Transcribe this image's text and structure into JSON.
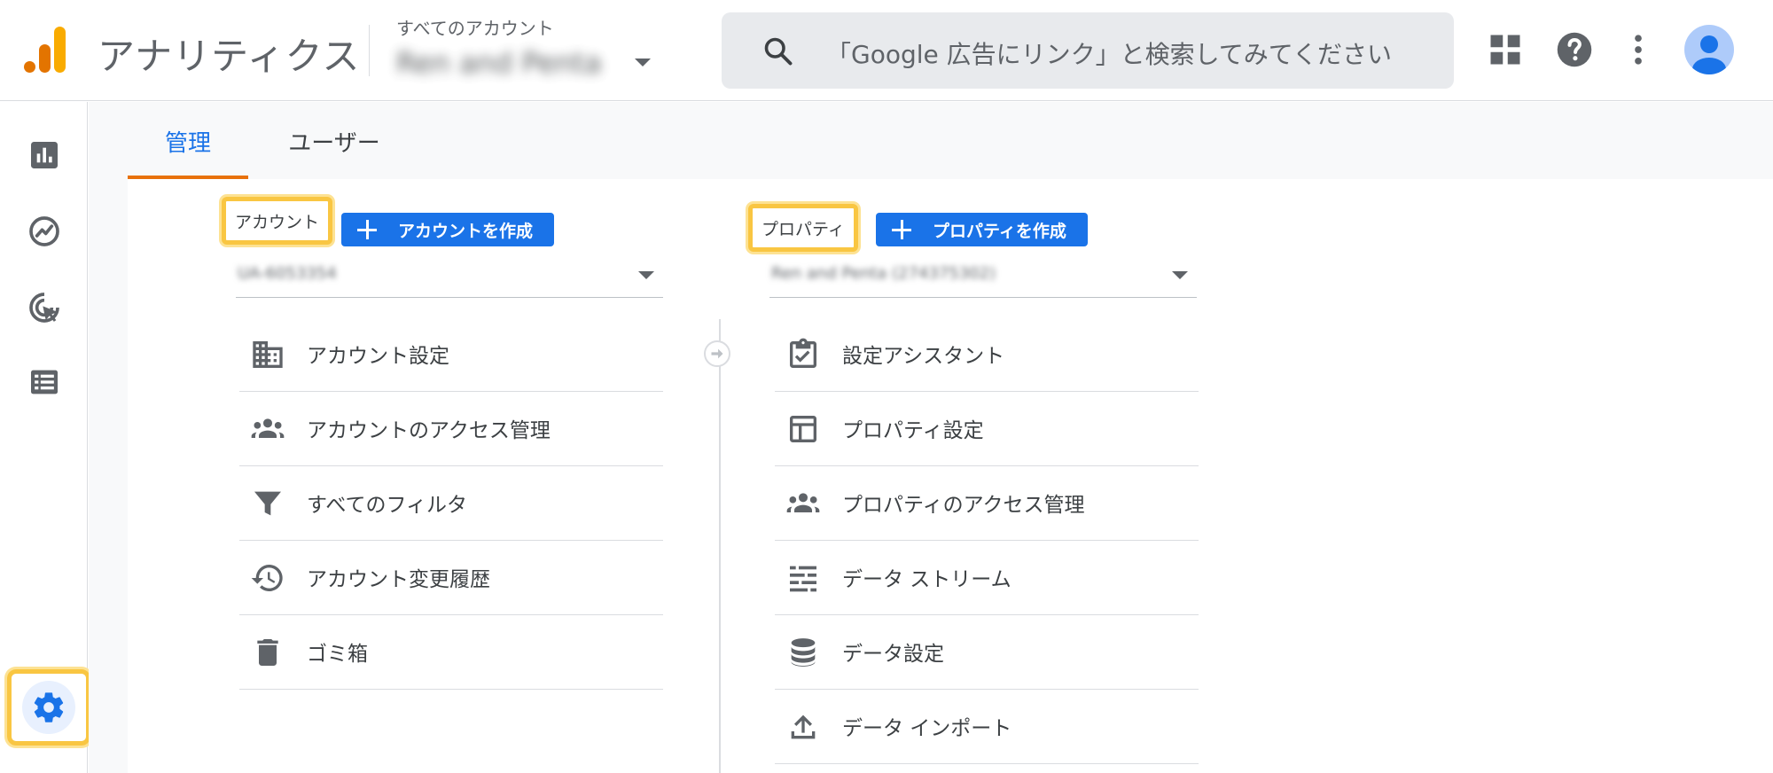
{
  "header": {
    "app_title": "アナリティクス",
    "account_caption": "すべてのアカウント",
    "account_name": "Ren and Penta",
    "search_placeholder": "「Google 広告にリンク」と検索してみてください",
    "icons": [
      "apps-icon",
      "help-icon",
      "more-vert-icon",
      "account-avatar-icon"
    ]
  },
  "rail": {
    "items": [
      "reports-icon",
      "explore-icon",
      "advertising-icon",
      "configure-icon"
    ],
    "admin": "admin-gear-icon"
  },
  "tabs": [
    {
      "label": "管理",
      "active": true
    },
    {
      "label": "ユーザー",
      "active": false
    }
  ],
  "account_column": {
    "label": "アカウント",
    "create_button": "アカウントを作成",
    "picker_value": "UA-6053354",
    "items": [
      {
        "label": "アカウント設定",
        "icon": "building-icon"
      },
      {
        "label": "アカウントのアクセス管理",
        "icon": "people-icon"
      },
      {
        "label": "すべてのフィルタ",
        "icon": "filter-icon"
      },
      {
        "label": "アカウント変更履歴",
        "icon": "history-icon"
      },
      {
        "label": "ゴミ箱",
        "icon": "trash-icon"
      }
    ]
  },
  "property_column": {
    "label": "プロパティ",
    "create_button": "プロパティを作成",
    "picker_value": "Ren and Penta (274375302)",
    "items": [
      {
        "label": "設定アシスタント",
        "icon": "clipboard-check-icon"
      },
      {
        "label": "プロパティ設定",
        "icon": "layout-icon"
      },
      {
        "label": "プロパティのアクセス管理",
        "icon": "people-icon"
      },
      {
        "label": "データ ストリーム",
        "icon": "data-stream-icon"
      },
      {
        "label": "データ設定",
        "icon": "database-icon"
      },
      {
        "label": "データ インポート",
        "icon": "upload-icon"
      }
    ]
  },
  "colors": {
    "accent_blue": "#1a73e8",
    "tab_underline": "#e8710a",
    "highlight": "#f9c642",
    "logo_orange": "#f9ab00",
    "logo_dark_orange": "#e37400"
  }
}
